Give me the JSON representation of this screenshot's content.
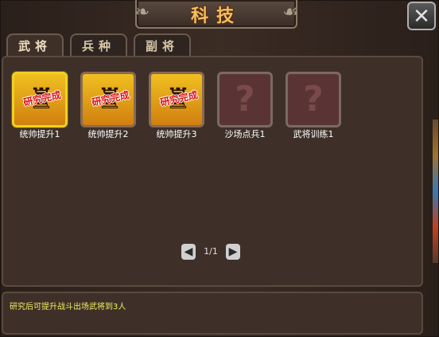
{
  "window": {
    "title": "科技",
    "close_label": "✕"
  },
  "tabs": [
    {
      "label": "武将",
      "active": true
    },
    {
      "label": "兵种",
      "active": false
    },
    {
      "label": "副将",
      "active": false
    }
  ],
  "techs": [
    {
      "name": "统帅提升1",
      "status": "研究完成",
      "unlocked": true,
      "selected": true
    },
    {
      "name": "统帅提升2",
      "status": "研究完成",
      "unlocked": true,
      "selected": false
    },
    {
      "name": "统帅提升3",
      "status": "研究完成",
      "unlocked": true,
      "selected": false
    },
    {
      "name": "沙场点兵1",
      "status": "",
      "unlocked": false,
      "selected": false
    },
    {
      "name": "武将训练1",
      "status": "",
      "unlocked": false,
      "selected": false
    }
  ],
  "pager": {
    "text": "1/1",
    "prev_icon": "◀",
    "next_icon": "▶"
  },
  "description": "研究后可提升战斗出场武将到3人",
  "colors": {
    "title": "#f0c060",
    "stamp": "#e01010",
    "description": "#f0f060",
    "selected_border": "#f0d020"
  },
  "icons": {
    "unknown": "?",
    "general": "♜"
  }
}
